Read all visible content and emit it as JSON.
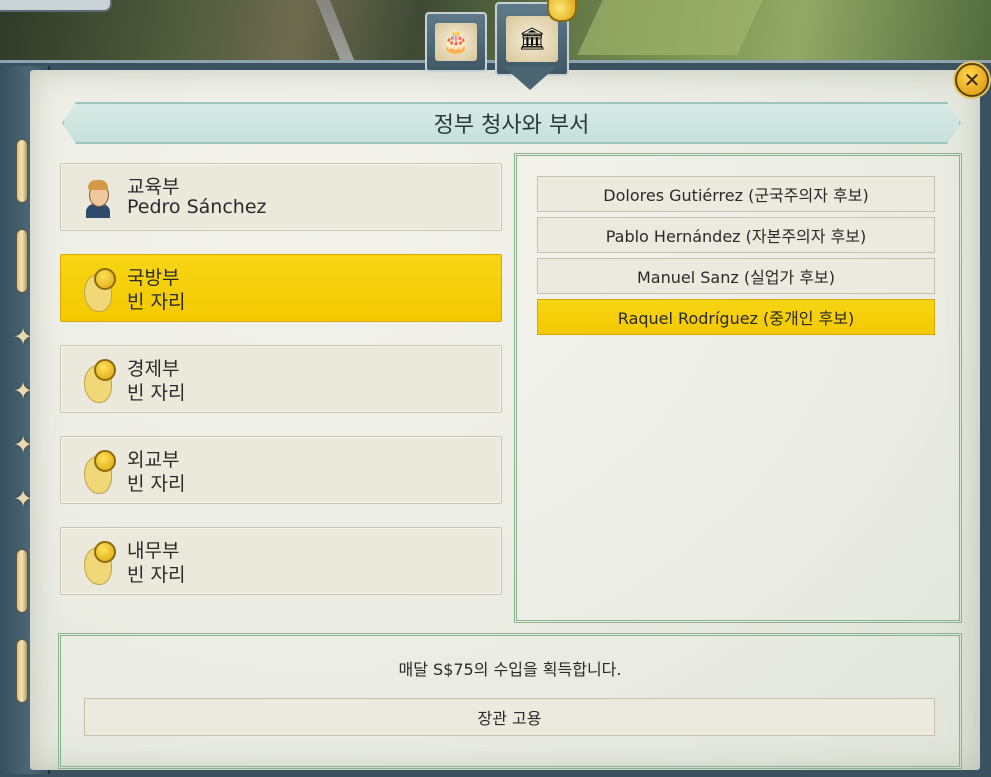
{
  "header": {
    "title": "정부 청사와 부서",
    "tabs": [
      {
        "icon": "cake-flags-icon"
      },
      {
        "icon": "palace-icon"
      }
    ],
    "close_icon": "close-icon"
  },
  "ministries": [
    {
      "name": "교육부",
      "holder": "Pedro Sánchez",
      "icon": "minister-portrait",
      "selected": false
    },
    {
      "name": "국방부",
      "holder": "빈 자리",
      "icon": "empty-slot-icon",
      "selected": true
    },
    {
      "name": "경제부",
      "holder": "빈 자리",
      "icon": "empty-slot-icon",
      "selected": false
    },
    {
      "name": "외교부",
      "holder": "빈 자리",
      "icon": "empty-slot-icon",
      "selected": false
    },
    {
      "name": "내무부",
      "holder": "빈 자리",
      "icon": "empty-slot-icon",
      "selected": false
    }
  ],
  "candidates": [
    {
      "label": "Dolores Gutiérrez (군국주의자 후보)",
      "selected": false
    },
    {
      "label": "Pablo Hernández (자본주의자 후보)",
      "selected": false
    },
    {
      "label": "Manuel Sanz (실업가 후보)",
      "selected": false
    },
    {
      "label": "Raquel Rodríguez (중개인 후보)",
      "selected": true
    }
  ],
  "footer": {
    "income_text": "매달 S$75의 수입을 획득합니다.",
    "hire_label": "장관 고용"
  },
  "colors": {
    "highlight": "#f3c900",
    "parchment": "#e9ebe2",
    "frame": "#3a5260"
  }
}
